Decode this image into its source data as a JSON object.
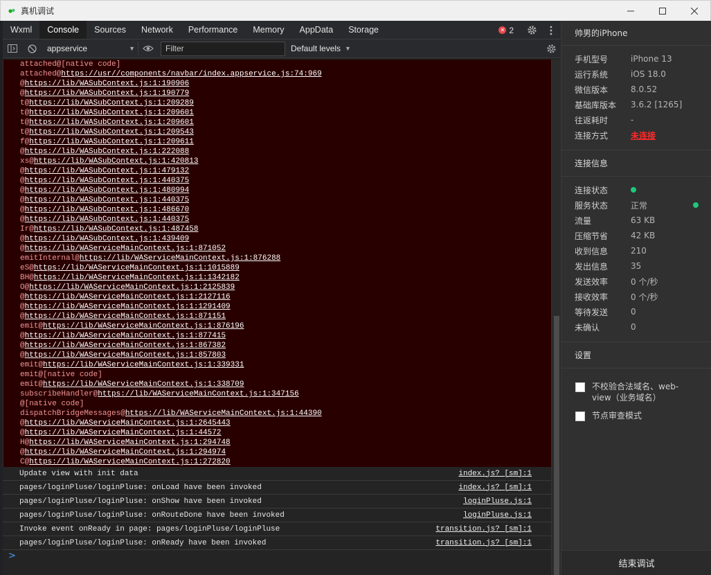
{
  "window": {
    "title": "真机调试"
  },
  "tabs": [
    "Wxml",
    "Console",
    "Sources",
    "Network",
    "Performance",
    "Memory",
    "AppData",
    "Storage"
  ],
  "active_tab": "Console",
  "errors": {
    "count": "2"
  },
  "toolbar": {
    "context": "appservice",
    "filter_placeholder": "Filter",
    "levels": "Default levels"
  },
  "stack_lines": [
    {
      "fn": "attached@[native code]",
      "url": ""
    },
    {
      "fn": "attached@",
      "url": "https://usr//components/navbar/index.appservice.js:74:969"
    },
    {
      "fn": "@",
      "url": "https://lib/WASubContext.js:1:190906"
    },
    {
      "fn": "@",
      "url": "https://lib/WASubContext.js:1:190779"
    },
    {
      "fn": "t@",
      "url": "https://lib/WASubContext.js:1:209289"
    },
    {
      "fn": "t@",
      "url": "https://lib/WASubContext.js:1:209601"
    },
    {
      "fn": "t@",
      "url": "https://lib/WASubContext.js:1:209601"
    },
    {
      "fn": "t@",
      "url": "https://lib/WASubContext.js:1:209543"
    },
    {
      "fn": "f@",
      "url": "https://lib/WASubContext.js:1:209611"
    },
    {
      "fn": "@",
      "url": "https://lib/WASubContext.js:1:222088"
    },
    {
      "fn": "xs@",
      "url": "https://lib/WASubContext.js:1:420813"
    },
    {
      "fn": "@",
      "url": "https://lib/WASubContext.js:1:479132"
    },
    {
      "fn": "@",
      "url": "https://lib/WASubContext.js:1:440375"
    },
    {
      "fn": "@",
      "url": "https://lib/WASubContext.js:1:480994"
    },
    {
      "fn": "@",
      "url": "https://lib/WASubContext.js:1:440375"
    },
    {
      "fn": "@",
      "url": "https://lib/WASubContext.js:1:486670"
    },
    {
      "fn": "@",
      "url": "https://lib/WASubContext.js:1:440375"
    },
    {
      "fn": "Ir@",
      "url": "https://lib/WASubContext.js:1:487458"
    },
    {
      "fn": "@",
      "url": "https://lib/WASubContext.js:1:439409"
    },
    {
      "fn": "@",
      "url": "https://lib/WAServiceMainContext.js:1:871052"
    },
    {
      "fn": "emitInternal@",
      "url": "https://lib/WAServiceMainContext.js:1:876288"
    },
    {
      "fn": "eS@",
      "url": "https://lib/WAServiceMainContext.js:1:1015889"
    },
    {
      "fn": "BH@",
      "url": "https://lib/WAServiceMainContext.js:1:1342182"
    },
    {
      "fn": "O@",
      "url": "https://lib/WAServiceMainContext.js:1:2125839"
    },
    {
      "fn": "@",
      "url": "https://lib/WAServiceMainContext.js:1:2127116"
    },
    {
      "fn": "@",
      "url": "https://lib/WAServiceMainContext.js:1:1291409"
    },
    {
      "fn": "@",
      "url": "https://lib/WAServiceMainContext.js:1:871151"
    },
    {
      "fn": "emit@",
      "url": "https://lib/WAServiceMainContext.js:1:876196"
    },
    {
      "fn": "@",
      "url": "https://lib/WAServiceMainContext.js:1:877415"
    },
    {
      "fn": "@",
      "url": "https://lib/WAServiceMainContext.js:1:867382"
    },
    {
      "fn": "@",
      "url": "https://lib/WAServiceMainContext.js:1:857803"
    },
    {
      "fn": "emit@",
      "url": "https://lib/WAServiceMainContext.js:1:339331"
    },
    {
      "fn": "emit@[native code]",
      "url": ""
    },
    {
      "fn": "emit@",
      "url": "https://lib/WAServiceMainContext.js:1:338709"
    },
    {
      "fn": "subscribeHandler@",
      "url": "https://lib/WAServiceMainContext.js:1:347156"
    },
    {
      "fn": "@[native code]",
      "url": ""
    },
    {
      "fn": "dispatchBridgeMessages@",
      "url": "https://lib/WAServiceMainContext.js:1:44390"
    },
    {
      "fn": "@",
      "url": "https://lib/WAServiceMainContext.js:1:2645443"
    },
    {
      "fn": "@",
      "url": "https://lib/WAServiceMainContext.js:1:44572"
    },
    {
      "fn": "H@",
      "url": "https://lib/WAServiceMainContext.js:1:294748"
    },
    {
      "fn": "@",
      "url": "https://lib/WAServiceMainContext.js:1:294974"
    },
    {
      "fn": "C@",
      "url": "https://lib/WAServiceMainContext.js:1:272820"
    }
  ],
  "messages": [
    {
      "text": "Update view with init data",
      "source": "index.js? [sm]:1"
    },
    {
      "text": "pages/loginPluse/loginPluse: onLoad have been invoked",
      "source": "index.js? [sm]:1"
    },
    {
      "text": "pages/loginPluse/loginPluse: onShow have been invoked",
      "source": "loginPluse.js:1"
    },
    {
      "text": "pages/loginPluse/loginPluse: onRouteDone have been invoked",
      "source": "loginPluse.js:1"
    },
    {
      "text": "Invoke event onReady in page: pages/loginPluse/loginPluse",
      "source": "transition.js? [sm]:1"
    },
    {
      "text": "pages/loginPluse/loginPluse: onReady have been invoked",
      "source": "transition.js? [sm]:1"
    }
  ],
  "prompt": ">",
  "panel": {
    "device_name": "帅男的iPhone",
    "device_info": [
      {
        "key": "手机型号",
        "value": "iPhone 13"
      },
      {
        "key": "运行系统",
        "value": "iOS 18.0"
      },
      {
        "key": "微信版本",
        "value": "8.0.52"
      },
      {
        "key": "基础库版本",
        "value": "3.6.2 [1265]"
      },
      {
        "key": "往返耗时",
        "value": "-"
      },
      {
        "key": "连接方式",
        "value": "未连接"
      }
    ],
    "connection_title": "连接信息",
    "connection_info": [
      {
        "key": "连接状态",
        "value": ""
      },
      {
        "key": "服务状态",
        "value": "正常"
      },
      {
        "key": "流量",
        "value": "63 KB"
      },
      {
        "key": "压缩节省",
        "value": "42 KB"
      },
      {
        "key": "收到信息",
        "value": "210"
      },
      {
        "key": "发出信息",
        "value": "35"
      },
      {
        "key": "发送效率",
        "value": "0 个/秒"
      },
      {
        "key": "接收效率",
        "value": "0 个/秒"
      },
      {
        "key": "等待发送",
        "value": "0"
      },
      {
        "key": "未确认",
        "value": "0"
      }
    ],
    "settings_title": "设置",
    "settings": [
      {
        "label": "不校验合法域名、web-view（业务域名）"
      },
      {
        "label": "节点审查模式"
      }
    ],
    "end_button": "结束调试"
  },
  "colors": {
    "status_green": "#1ec77a",
    "error_red": "#ff2a2a",
    "stack_bg": "#290000"
  }
}
